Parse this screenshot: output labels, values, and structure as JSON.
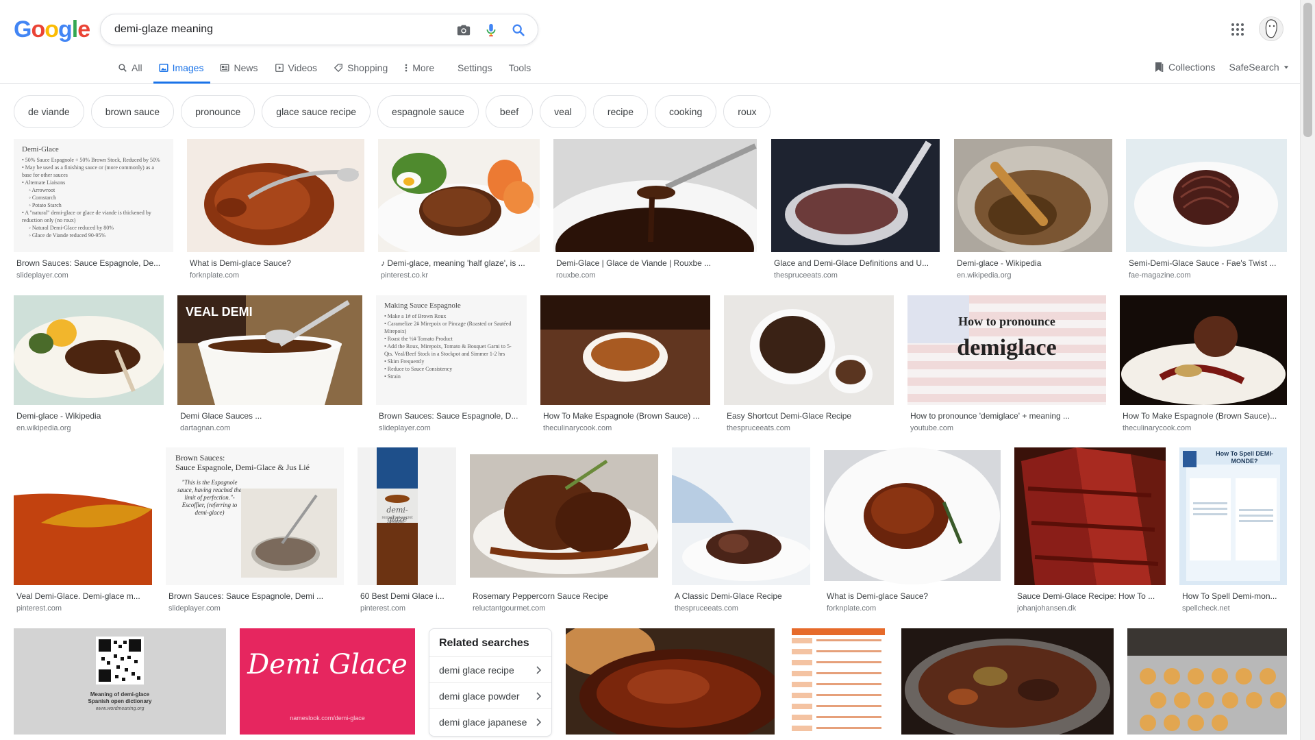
{
  "search": {
    "query": "demi-glaze meaning"
  },
  "tabs": [
    "All",
    "Images",
    "News",
    "Videos",
    "Shopping",
    "More"
  ],
  "tools": {
    "settings": "Settings",
    "tools": "Tools"
  },
  "right": {
    "collections": "Collections",
    "safesearch": "SafeSearch"
  },
  "chips": [
    "de viande",
    "brown sauce",
    "pronounce",
    "glace sauce recipe",
    "espagnole sauce",
    "beef",
    "veal",
    "recipe",
    "cooking",
    "roux"
  ],
  "results": [
    {
      "caption": "Brown Sauces: Sauce Espagnole, De...",
      "source": "slideplayer.com"
    },
    {
      "caption": "What is Demi-glace Sauce?",
      "source": "forknplate.com"
    },
    {
      "caption": "♪ Demi-glace, meaning 'half glaze', is ...",
      "source": "pinterest.co.kr"
    },
    {
      "caption": "Demi-Glace | Glace de Viande | Rouxbe ...",
      "source": "rouxbe.com"
    },
    {
      "caption": "Glace and Demi-Glace Definitions and U...",
      "source": "thespruceeats.com"
    },
    {
      "caption": "Demi-glace - Wikipedia",
      "source": "en.wikipedia.org"
    },
    {
      "caption": "Semi-Demi-Glace Sauce - Fae's Twist ...",
      "source": "fae-magazine.com"
    },
    {
      "caption": "Demi-glace - Wikipedia",
      "source": "en.wikipedia.org"
    },
    {
      "caption": "Demi Glace Sauces ...",
      "source": "dartagnan.com"
    },
    {
      "caption": "Brown Sauces: Sauce Espagnole, D...",
      "source": "slideplayer.com"
    },
    {
      "caption": "How To Make Espagnole (Brown Sauce) ...",
      "source": "theculinarycook.com"
    },
    {
      "caption": "Easy Shortcut Demi-Glace Recipe",
      "source": "thespruceeats.com"
    },
    {
      "caption": "How to pronounce 'demiglace' + meaning ...",
      "source": "youtube.com"
    },
    {
      "caption": "How To Make Espagnole (Brown Sauce)...",
      "source": "theculinarycook.com"
    },
    {
      "caption": "Veal Demi-Glace. Demi-glace m...",
      "source": "pinterest.com"
    },
    {
      "caption": "Brown Sauces: Sauce Espagnole, Demi ...",
      "source": "slideplayer.com"
    },
    {
      "caption": "60 Best Demi Glace i...",
      "source": "pinterest.com"
    },
    {
      "caption": "Rosemary Peppercorn Sauce Recipe",
      "source": "reluctantgourmet.com"
    },
    {
      "caption": "A Classic Demi-Glace Recipe",
      "source": "thespruceeats.com"
    },
    {
      "caption": "What is Demi-glace Sauce?",
      "source": "forknplate.com"
    },
    {
      "caption": "Sauce Demi-Glace Recipe: How To ...",
      "source": "johanjohansen.dk"
    },
    {
      "caption": "How To Spell Demi-mon...",
      "source": "spellcheck.net"
    }
  ],
  "thumb_text": {
    "demi_glace_doc": {
      "title": "Demi-Glace",
      "lines": [
        "• 50% Sauce Espagnole + 50% Brown Stock, Reduced by 50%",
        "• May be used as a finishing sauce or (more commonly) as a base for other sauces",
        "• Alternate Liaisons",
        "◦ Arrowroot",
        "◦ Cornstarch",
        "◦ Potato Starch",
        "• A \"natural\" demi-glace or glace de viande is thickened by reduction only (no roux)",
        "◦ Natural Demi-Glace reduced by 80%",
        "◦ Glace de Viande reduced 90-95%"
      ]
    },
    "espagnole_doc": {
      "title": "Making Sauce Espagnole",
      "lines": [
        "• Make a 1# of Brown Roux",
        "• Caramelize 2# Mirepoix or Pincage (Roasted or Sautéed Mirepoix)",
        "• Roast the ½# Tomato Product",
        "• Add the Roux, Mirepoix, Tomato & Bouquet Garni to 5-Qts. Veal/Beef Stock in a Stockpot and Simmer 1-2 hrs",
        "• Skim Frequently",
        "• Reduce to Sauce Consistency",
        "• Strain"
      ]
    },
    "veal_demi_label": "VEAL DEMI",
    "pronounce_top": "How to pronounce",
    "pronounce_word": "demiglace",
    "brown_sauces_title": "Brown Sauces:",
    "brown_sauces_sub": "Sauce Espagnole, Demi-Glace & Jus Lié",
    "brown_sauces_quote": "\"This is the Espagnole sauce, having reached the limit of perfection.\"- Escoffier, (referring to demi-glace)",
    "demi_jar_word": "demi-glaze",
    "demi_jar_sub": "restaurant secret weapon",
    "spell_title": "How To Spell DEMI-MONDE?",
    "qr_line1": "Meaning of demi-glace",
    "qr_line2": "Spanish open dictionary",
    "qr_line3": "www.wordmeaning.org",
    "nameslook_word": "Demi Glace",
    "nameslook_url": "nameslook.com/demi-glace"
  },
  "related": {
    "title": "Related searches",
    "items": [
      "demi glace recipe",
      "demi glace powder",
      "demi glace japanese"
    ]
  }
}
